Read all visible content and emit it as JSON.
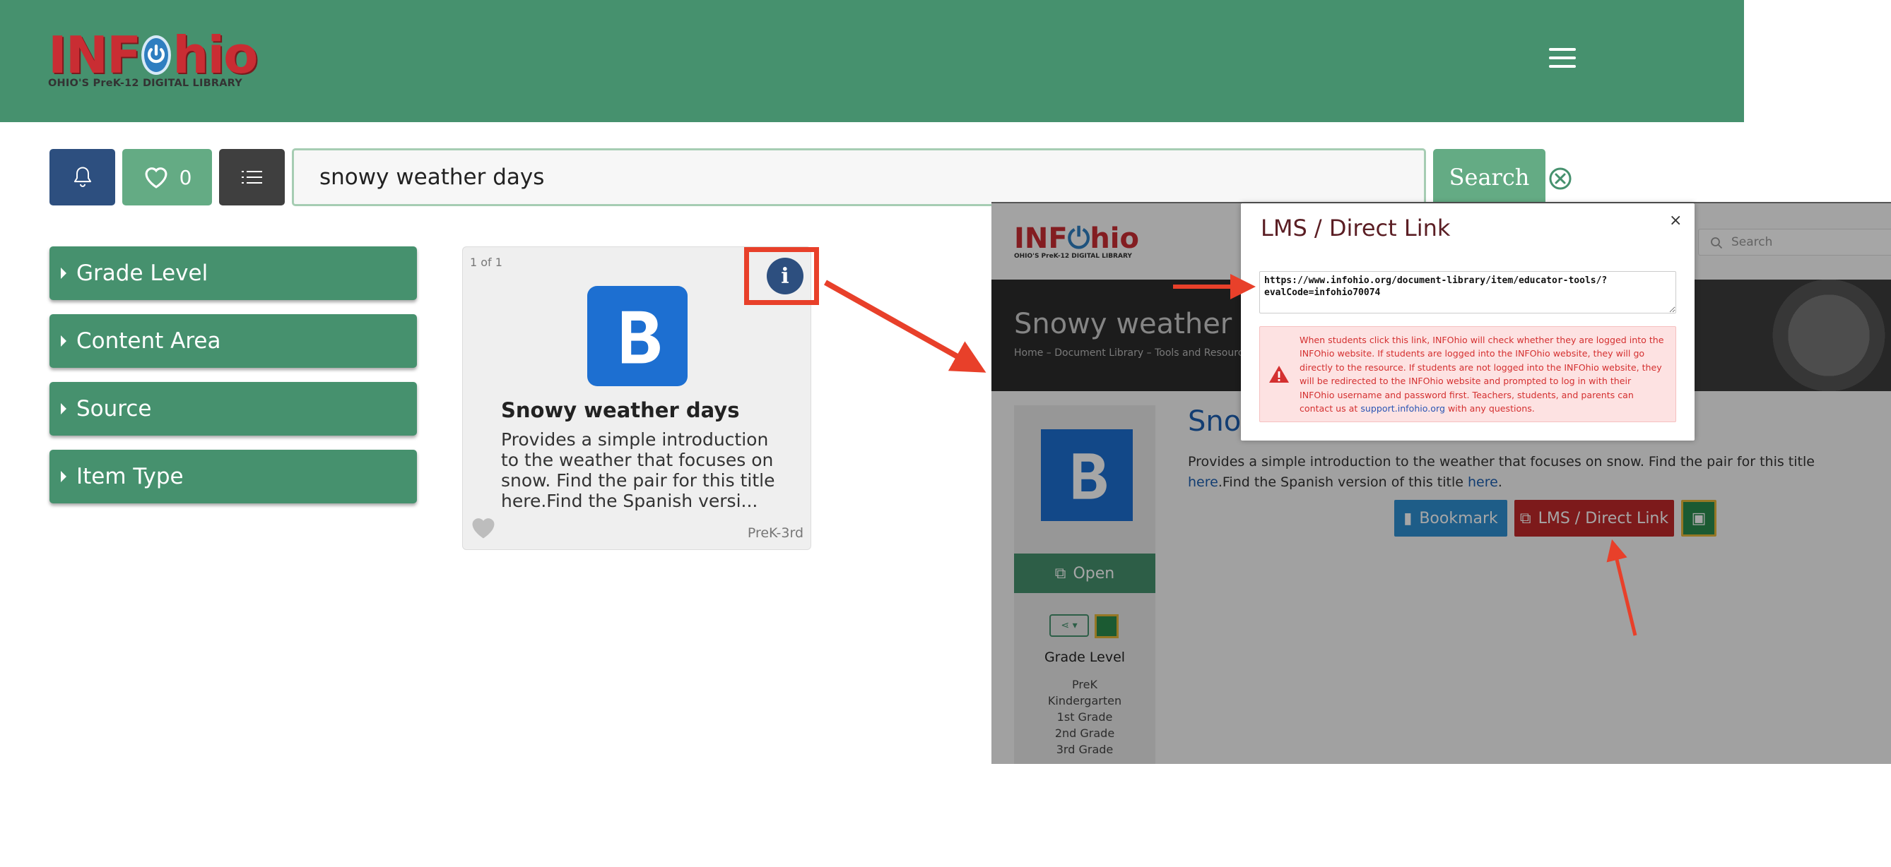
{
  "header": {
    "logo_left": "INF",
    "logo_right": "hio",
    "logo_tagline": "OHIO'S PreK-12 DIGITAL LIBRARY"
  },
  "search": {
    "query": "snowy weather days",
    "button_label": "Search",
    "favorites_count": "0"
  },
  "filters": [
    "Grade Level",
    "Content Area",
    "Source",
    "Item Type"
  ],
  "card": {
    "count": "1 of 1",
    "info_glyph": "i",
    "title": "Snowy weather days",
    "description": "Provides a simple introduction to the weather that focuses on snow. Find the pair for this title here.Find the Spanish versi...",
    "grade": "PreK-3rd"
  },
  "inset": {
    "search_placeholder": "Search",
    "banner_title": "Snowy weather da",
    "breadcrumbs": "Home  –  Document Library  –  Tools and Resources for",
    "main_title": "Snow",
    "desc_1": "Provides a simple introduction to the weather that focuses on snow. Find the pair for this title ",
    "desc_link_1": "here",
    "desc_2": ".Find the Spanish version of this title ",
    "desc_link_2": "here",
    "desc_3": ".",
    "bookmark_label": "Bookmark",
    "lms_label": "LMS / Direct Link",
    "open_label": "Open",
    "grade_level_heading": "Grade Level",
    "grades": [
      "PreK",
      "Kindergarten",
      "1st Grade",
      "2nd Grade",
      "3rd Grade"
    ]
  },
  "modal": {
    "title": "LMS / Direct Link",
    "close": "×",
    "url": "https://www.infohio.org/document-library/item/educator-tools/?evalCode=infohio70074",
    "alert_text": "When students click this link, INFOhio will check whether they are logged into the INFOhio website. If students are logged into the INFOhio website, they will go directly to the resource. If students are not logged into the INFOhio website, they will be redirected to the INFOhio website and prompted to log in with their INFOhio username and password first. Teachers, students, and parents can contact us at ",
    "alert_link": "support.infohio.org",
    "alert_tail": " with any questions."
  },
  "colors": {
    "brand_green": "#46916e",
    "light_green": "#64ab84",
    "navy": "#2d4f7f",
    "highlight_red": "#e8402a",
    "lms_red": "#c0282a"
  }
}
